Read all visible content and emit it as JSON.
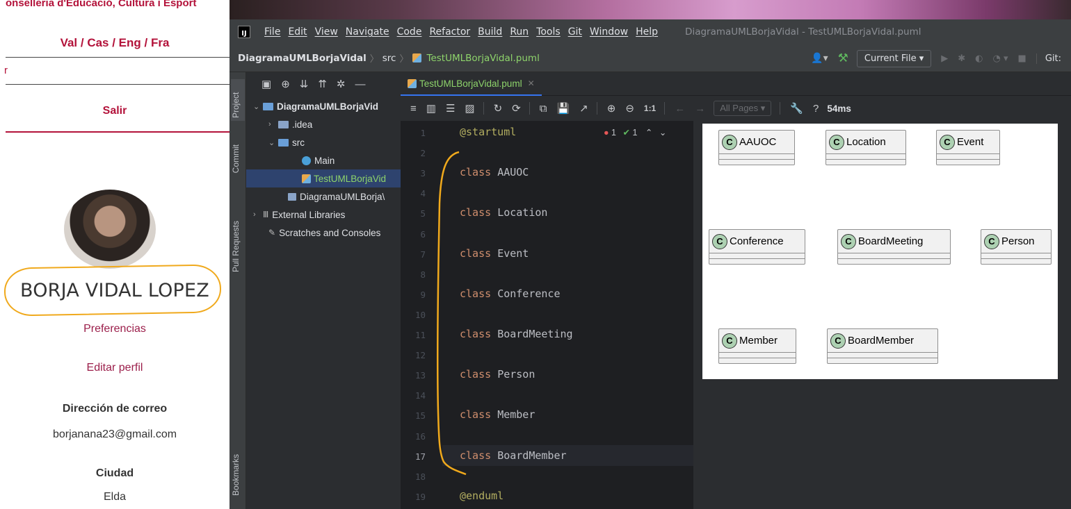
{
  "web": {
    "header": "onselleria d'Educació, Cultura i Esport",
    "languages": "Val / Cas / Eng / Fra",
    "input_fragment": "r",
    "logout": "Salir",
    "user_name": "BORJA VIDAL LOPEZ",
    "preferences": "Preferencias",
    "edit_profile": "Editar perfil",
    "email_label": "Dirección de correo",
    "email": "borjanana23@gmail.com",
    "city_label": "Ciudad",
    "city": "Elda"
  },
  "ide": {
    "logo": "IJ",
    "menu": [
      "File",
      "Edit",
      "View",
      "Navigate",
      "Code",
      "Refactor",
      "Build",
      "Run",
      "Tools",
      "Git",
      "Window",
      "Help"
    ],
    "window_title": "DiagramaUMLBorjaVidal - TestUMLBorjaVidal.puml",
    "breadcrumb": {
      "project": "DiagramaUMLBorjaVidal",
      "folder": "src",
      "file": "TestUMLBorjaVidal.puml"
    },
    "run_config": "Current File ▾",
    "git_label": "Git:",
    "side_tabs": {
      "project": "Project",
      "commit": "Commit",
      "pull_requests": "Pull Requests",
      "bookmarks": "Bookmarks"
    },
    "tree": {
      "root": "DiagramaUMLBorjaVid",
      "idea": ".idea",
      "src": "src",
      "main": "Main",
      "puml": "TestUMLBorjaVid",
      "iml": "DiagramaUMLBorja\\",
      "libs": "External Libraries",
      "scratches": "Scratches and Consoles"
    },
    "tab_label": "TestUMLBorjaVidal.puml",
    "preview_toolbar": {
      "zoom_label": "1:1",
      "pages": "All Pages ▾",
      "render_time": "54ms"
    },
    "inspections": {
      "errors": "1",
      "passed": "1"
    },
    "line_numbers": [
      "1",
      "2",
      "3",
      "4",
      "5",
      "6",
      "7",
      "8",
      "9",
      "10",
      "11",
      "12",
      "13",
      "14",
      "15",
      "16",
      "17",
      "18",
      "19"
    ],
    "current_line": "17",
    "code": {
      "start": "@startuml",
      "end": "@enduml",
      "keyword": "class",
      "classes": [
        "AAUOC",
        "Location",
        "Event",
        "Conference",
        "BoardMeeting",
        "Person",
        "Member",
        "BoardMember"
      ]
    }
  },
  "diagram": {
    "circle_letter": "C",
    "classes": [
      "AAUOC",
      "Location",
      "Event",
      "Conference",
      "BoardMeeting",
      "Person",
      "Member",
      "BoardMember"
    ]
  },
  "colors": {
    "web_accent": "#b3123a",
    "annotation": "#f0a91c",
    "ide_bg": "#2b2d30",
    "editor_bg": "#1e1f22",
    "keyword": "#cf8e6d",
    "uml_class_badge": "#add1b2"
  }
}
